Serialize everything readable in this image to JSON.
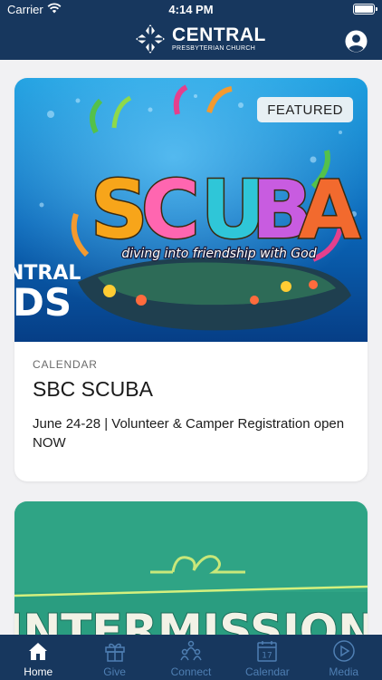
{
  "status_bar": {
    "carrier": "Carrier",
    "time": "4:14 PM"
  },
  "header": {
    "brand_name": "CENTRAL",
    "brand_sub": "PRESBYTERIAN CHURCH"
  },
  "feed": {
    "cards": [
      {
        "badge": "FEATURED",
        "image_text": {
          "headline": "SCUBA",
          "tagline": "diving into friendship with God",
          "side_word_1": "NTRAL",
          "side_word_2": "DS"
        },
        "category": "CALENDAR",
        "title": "SBC SCUBA",
        "description": "June 24-28 | Volunteer & Camper Registration open NOW"
      },
      {
        "image_text": {
          "headline": "INTERMISSION"
        }
      }
    ]
  },
  "tabs": [
    {
      "label": "Home",
      "icon": "home-icon",
      "active": true
    },
    {
      "label": "Give",
      "icon": "gift-icon",
      "active": false
    },
    {
      "label": "Connect",
      "icon": "people-icon",
      "active": false
    },
    {
      "label": "Calendar",
      "icon": "calendar-icon",
      "active": false
    },
    {
      "label": "Media",
      "icon": "play-icon",
      "active": false
    }
  ],
  "calendar_icon_day": "17",
  "colors": {
    "brand_navy": "#17375e",
    "tab_inactive": "#4f7fb3",
    "tab_active": "#ffffff",
    "background": "#f1f1f3"
  }
}
